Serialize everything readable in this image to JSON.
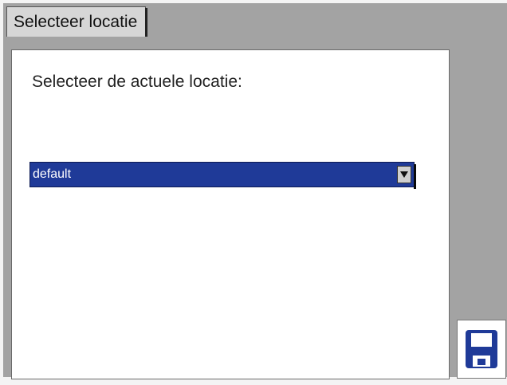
{
  "tab": {
    "label": "Selecteer locatie"
  },
  "panel": {
    "prompt": "Selecteer de actuele locatie:",
    "location_select": {
      "selected": "default"
    }
  },
  "icons": {
    "dropdown": "chevron-down-icon",
    "save": "floppy-disk-icon"
  },
  "colors": {
    "select_background": "#1f3a98",
    "save_icon": "#1f3a98",
    "screen_background": "#a3a3a3"
  }
}
